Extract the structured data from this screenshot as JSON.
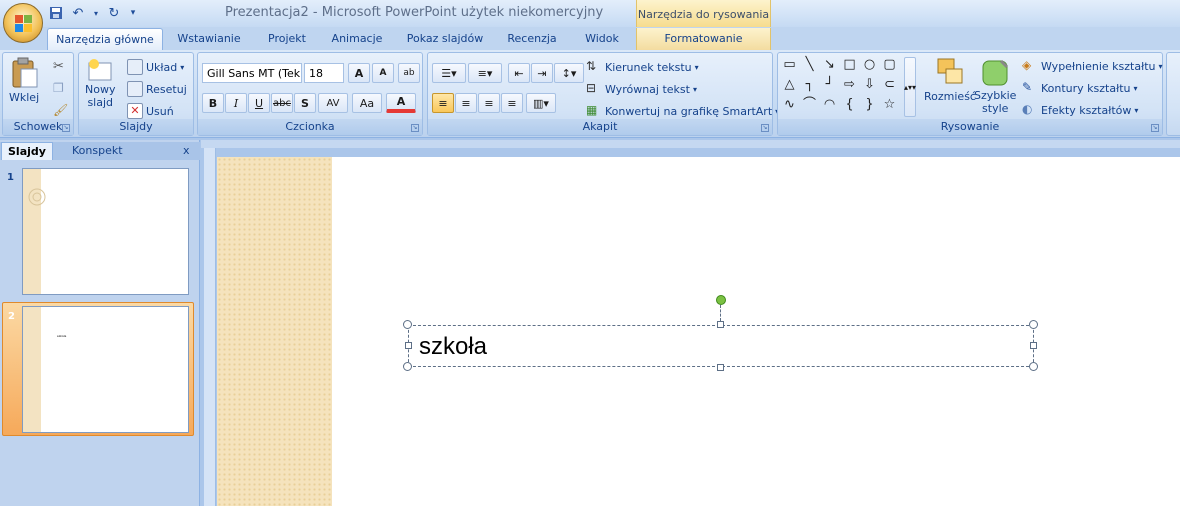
{
  "title_bar": {
    "title": "Prezentacja2 - Microsoft PowerPoint użytek niekomercyjny",
    "context_header": "Narzędzia do rysowania"
  },
  "quick_access": {
    "icons": [
      "save-icon",
      "undo-icon",
      "redo-icon",
      "customize-icon"
    ]
  },
  "tabs": [
    {
      "label": "Narzędzia główne",
      "active": true
    },
    {
      "label": "Wstawianie"
    },
    {
      "label": "Projekt"
    },
    {
      "label": "Animacje"
    },
    {
      "label": "Pokaz slajdów"
    },
    {
      "label": "Recenzja"
    },
    {
      "label": "Widok"
    },
    {
      "label": "Formatowanie",
      "contextual": true
    }
  ],
  "ribbon": {
    "clipboard": {
      "paste_line": "Wklej",
      "group": "Schowek"
    },
    "slides": {
      "new_slide_line1": "Nowy",
      "new_slide_line2": "slajd",
      "layout": "Układ",
      "reset": "Resetuj",
      "delete": "Usuń",
      "group": "Slajdy"
    },
    "font": {
      "family": "Gill Sans MT (Tek",
      "size": "18",
      "grow": "A",
      "shrink": "A",
      "bold": "B",
      "italic": "I",
      "underline": "U",
      "strike": "abc",
      "shadow": "S",
      "spacing": "AV",
      "case": "Aa",
      "color": "A",
      "group": "Czcionka"
    },
    "paragraph": {
      "text_direction": "Kierunek tekstu",
      "align_text": "Wyrównaj tekst",
      "smartart": "Konwertuj na grafikę SmartArt",
      "group": "Akapit"
    },
    "drawing": {
      "arrange": "Rozmieść",
      "quick_styles_line1": "Szybkie",
      "quick_styles_line2": "style",
      "fill": "Wypełnienie kształtu",
      "outline": "Kontury kształtu",
      "effects": "Efekty kształtów",
      "group": "Rysowanie"
    }
  },
  "left_pane": {
    "tab_slides": "Slajdy",
    "tab_outline": "Konspekt",
    "close": "x",
    "slides": [
      {
        "number": "1",
        "selected": false
      },
      {
        "number": "2",
        "selected": true,
        "mini_text": "szkoła"
      }
    ]
  },
  "slide": {
    "textbox_text": "szkoła"
  },
  "colors": {
    "ribbon_bg": "#c6dbf3",
    "selected_thumb": "#f6b66a",
    "slide_decor": "#f5e3bd",
    "rotation_handle": "#7bc143"
  }
}
